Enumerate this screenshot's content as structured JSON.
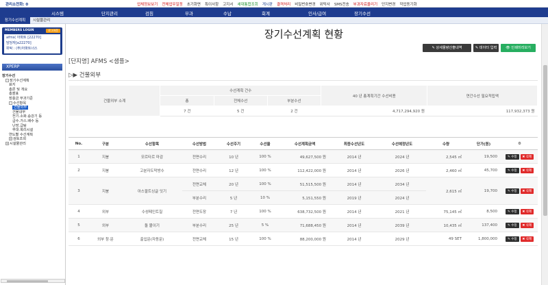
{
  "topbar": {
    "admin": "관리소전화: 0",
    "links": [
      {
        "label": "업체정보보기",
        "color": "r"
      },
      {
        "label": "전체업무일정",
        "color": "r"
      },
      {
        "label": "초기화면",
        "color": ""
      },
      {
        "label": "특이사항",
        "color": ""
      },
      {
        "label": "고지서",
        "color": ""
      },
      {
        "label": "세대통합조회",
        "color": "g"
      },
      {
        "label": "게시판",
        "color": "b"
      },
      {
        "label": "결격처리",
        "color": "r"
      },
      {
        "label": "비밀번호변경",
        "color": ""
      },
      {
        "label": "위탁사",
        "color": ""
      },
      {
        "label": "SMS전송",
        "color": ""
      },
      {
        "label": "부과자료올리기",
        "color": "r"
      },
      {
        "label": "단지변경",
        "color": ""
      },
      {
        "label": "작업동기화",
        "color": ""
      }
    ]
  },
  "mainnav": [
    "시스템",
    "단지관리",
    "검침",
    "부과",
    "수납",
    "회계",
    "인사/급여",
    "장기수선"
  ],
  "subnav": {
    "active": "장기수선계획",
    "other": "시설물관리"
  },
  "login": {
    "title": "MEMBERS LOGIN",
    "logout": "로그아웃",
    "lines": [
      "afms( 아파트 [22270]",
      "담당자[a22270]",
      "위탁 : (주)아파트너스"
    ]
  },
  "xperp": "XPERP",
  "tree": [
    {
      "label": "장기수선",
      "indent": 0,
      "pm": "",
      "bold": true
    },
    {
      "label": "장기수선계획",
      "indent": 1,
      "pm": "-"
    },
    {
      "label": "표지",
      "indent": 2,
      "pm": ""
    },
    {
      "label": "총론 및 개요",
      "indent": 2,
      "pm": ""
    },
    {
      "label": "총괄표",
      "indent": 2,
      "pm": ""
    },
    {
      "label": "장충금 부과기준",
      "indent": 2,
      "pm": ""
    },
    {
      "label": "수선항목",
      "indent": 2,
      "pm": "-"
    },
    {
      "label": "건물외부",
      "indent": 3,
      "pm": "",
      "sel": true
    },
    {
      "label": "건물내부",
      "indent": 3,
      "pm": ""
    },
    {
      "label": "전기.소화.승강기 등",
      "indent": 3,
      "pm": ""
    },
    {
      "label": "급수.가스.배수 등",
      "indent": 3,
      "pm": ""
    },
    {
      "label": "난방.급탕",
      "indent": 3,
      "pm": ""
    },
    {
      "label": "부대.복리시설",
      "indent": 3,
      "pm": ""
    },
    {
      "label": "연도별 수선계획",
      "indent": 2,
      "pm": ""
    },
    {
      "label": "검토조회",
      "indent": 2,
      "pm": "+"
    },
    {
      "label": "시설물관리",
      "indent": 1,
      "pm": "+"
    }
  ],
  "page": {
    "title": "장기수선계획 현황",
    "buttons": [
      {
        "label": "✎ 상세물량산출내역",
        "icon": "pencil-icon"
      },
      {
        "label": "✎ 데이터 입력",
        "icon": "pencil-icon"
      },
      {
        "label": "👁 인쇄미리보기",
        "icon": "eye-icon"
      }
    ],
    "site": "[단지명] AFMS <샘플>",
    "section": "▷▶ 건물외부"
  },
  "summary": {
    "rowhead": "건물외부 소계",
    "count_head": "수선계획 건수",
    "total_label": "총",
    "full_label": "전체수선",
    "partial_label": "부분수선",
    "total": "7 건",
    "full": "5 건",
    "partial": "2 건",
    "cost40_head": "40 년 총계획기간 수선비용",
    "cost40": "4,717,294,920 원",
    "yearly_head": "연간수선 필요적립액",
    "yearly": "117,932,373 원"
  },
  "table": {
    "headers": [
      "No.",
      "구분",
      "수선항목",
      "수선방법",
      "수선주기",
      "수선율",
      "수선계획금액",
      "최종수선년도",
      "수선예정년도",
      "수량",
      "단가(원)",
      "⚙"
    ],
    "edit_label": "✎ 수정",
    "delete_label": "✖ 삭제",
    "rows": [
      {
        "no": "1",
        "cat": "지붕",
        "item": "모르타르 마감",
        "lines": [
          {
            "method": "전면수리",
            "cycle": "10 년",
            "rate": "100 %",
            "amount": "49,627,500 원",
            "last": "2014 년",
            "next": "2024 년"
          }
        ],
        "qty": "2,545 ㎡",
        "price": "19,500"
      },
      {
        "no": "2",
        "cat": "지붕",
        "item": "고분자도막방수",
        "lines": [
          {
            "method": "전면수리",
            "cycle": "12 년",
            "rate": "100 %",
            "amount": "112,422,000 원",
            "last": "2014 년",
            "next": "2026 년"
          }
        ],
        "qty": "2,460 ㎡",
        "price": "45,700"
      },
      {
        "no": "3",
        "cat": "지붕",
        "item": "아스팔트싱글 잇기",
        "lines": [
          {
            "method": "전면교체",
            "cycle": "20 년",
            "rate": "100 %",
            "amount": "51,515,500 원",
            "last": "2014 년",
            "next": "2034 년"
          },
          {
            "method": "부분수리",
            "cycle": "5 년",
            "rate": "10 %",
            "amount": "5,151,550 원",
            "last": "2019 년",
            "next": "2024 년"
          }
        ],
        "qty": "2,615 ㎡",
        "price": "19,700"
      },
      {
        "no": "4",
        "cat": "외부",
        "item": "수성페인트칠",
        "lines": [
          {
            "method": "전면도장",
            "cycle": "7 년",
            "rate": "100 %",
            "amount": "638,732,500 원",
            "last": "2014 년",
            "next": "2021 년"
          }
        ],
        "qty": "75,145 ㎡",
        "price": "8,500"
      },
      {
        "no": "5",
        "cat": "외부",
        "item": "돌 붙이기",
        "lines": [
          {
            "method": "부분수리",
            "cycle": "25 년",
            "rate": "5 %",
            "amount": "71,688,450 원",
            "last": "2014 년",
            "next": "2039 년"
          }
        ],
        "qty": "10,435 ㎡",
        "price": "137,400"
      },
      {
        "no": "6",
        "cat": "외부 창·문",
        "item": "출입문(자동문)",
        "lines": [
          {
            "method": "전면교체",
            "cycle": "15 년",
            "rate": "100 %",
            "amount": "88,200,000 원",
            "last": "2014 년",
            "next": "2029 년"
          }
        ],
        "qty": "49 SET",
        "price": "1,800,000"
      }
    ]
  }
}
